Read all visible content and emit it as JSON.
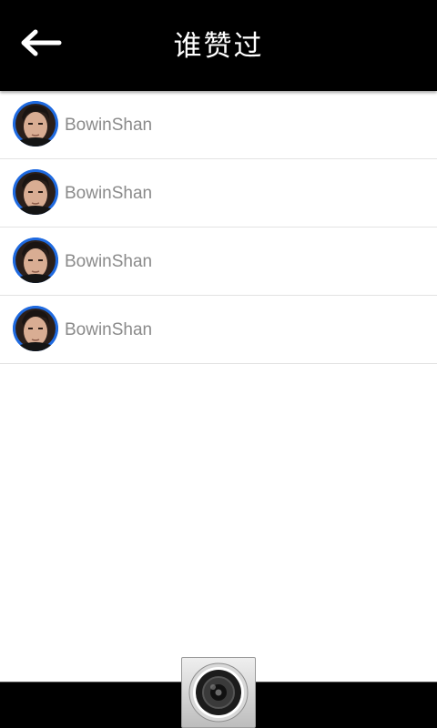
{
  "header": {
    "title": "谁赞过",
    "back_icon": "arrow-left-icon"
  },
  "users": [
    {
      "name": "BowinShan",
      "avatar_icon": "user-avatar"
    },
    {
      "name": "BowinShan",
      "avatar_icon": "user-avatar"
    },
    {
      "name": "BowinShan",
      "avatar_icon": "user-avatar"
    },
    {
      "name": "BowinShan",
      "avatar_icon": "user-avatar"
    }
  ],
  "bottom_bar": {
    "camera_icon": "camera-lens-icon"
  },
  "colors": {
    "header_bg": "#000000",
    "title_text": "#ffffff",
    "username_text": "#8a8a8a",
    "avatar_ring": "#1f6ae0",
    "divider": "#e3e3e3"
  }
}
